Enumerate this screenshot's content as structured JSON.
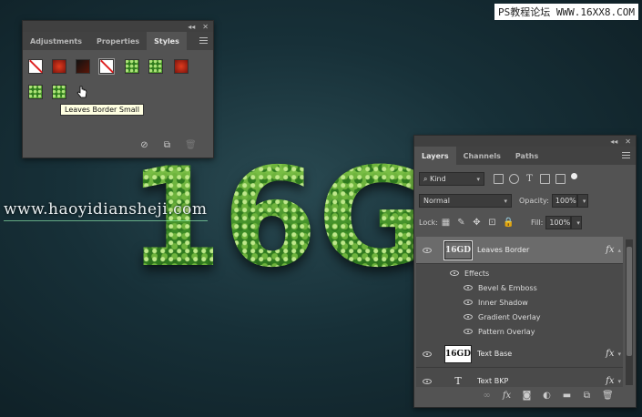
{
  "watermark_top": "PS教程论坛 WWW.16XX8.COM",
  "watermark_left": "www.haoyidiansheji.com",
  "art_text": "16G",
  "styles_panel": {
    "tabs": [
      {
        "label": "Adjustments",
        "active": false
      },
      {
        "label": "Properties",
        "active": false
      },
      {
        "label": "Styles",
        "active": true
      }
    ],
    "swatches": [
      "none",
      "red",
      "dark",
      "none",
      "leaf",
      "leaf",
      "red",
      "leaf",
      "leaf"
    ],
    "tooltip": "Leaves Border Small",
    "bottom_icons": [
      "clear-style-icon",
      "new-style-icon",
      "delete-icon"
    ]
  },
  "layers_panel": {
    "tabs": [
      {
        "label": "Layers",
        "active": true
      },
      {
        "label": "Channels",
        "active": false
      },
      {
        "label": "Paths",
        "active": false
      }
    ],
    "filter": {
      "kind_label": "Kind"
    },
    "blend_mode": "Normal",
    "opacity_label": "Opacity:",
    "opacity_value": "100%",
    "lock_label": "Lock:",
    "fill_label": "Fill:",
    "fill_value": "100%",
    "layers": [
      {
        "name": "Leaves Border",
        "thumb": "16GD",
        "selected": true,
        "fx": "fx"
      },
      {
        "name": "Text Base",
        "thumb": "16GD",
        "selected": false,
        "fx": "fx"
      },
      {
        "name": "Text BKP",
        "thumb": "T",
        "selected": false,
        "fx": "fx"
      }
    ],
    "effects_label": "Effects",
    "effects": [
      "Bevel & Emboss",
      "Inner Shadow",
      "Gradient Overlay",
      "Pattern Overlay"
    ],
    "bottom_icons": [
      "link-icon",
      "fx-icon",
      "mask-icon",
      "adjustment-icon",
      "folder-icon",
      "new-layer-icon",
      "trash-icon"
    ]
  }
}
